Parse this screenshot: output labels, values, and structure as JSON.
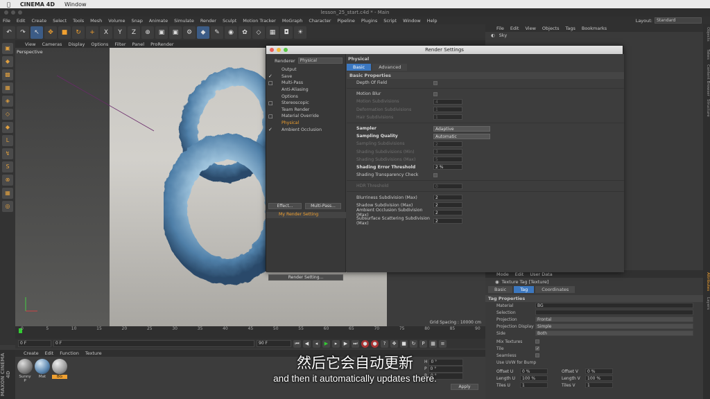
{
  "mac": {
    "app": "CINEMA 4D",
    "window_menu": "Window"
  },
  "window_title": "lesson_25_start.c4d * - Main",
  "menubar": [
    "File",
    "Edit",
    "Create",
    "Select",
    "Tools",
    "Mesh",
    "Volume",
    "Snap",
    "Animate",
    "Simulate",
    "Render",
    "Sculpt",
    "Motion Tracker",
    "MoGraph",
    "Character",
    "Pipeline",
    "Plugins",
    "Script",
    "Window",
    "Help"
  ],
  "layout": {
    "label": "Layout:",
    "value": "Standard"
  },
  "viewport": {
    "menu": [
      "View",
      "Cameras",
      "Display",
      "Options",
      "Filter",
      "Panel",
      "ProRender"
    ],
    "camera": "Perspective",
    "grid_spacing": "Grid Spacing : 10000 cm"
  },
  "timeline": {
    "ticks": [
      "0",
      "5",
      "10",
      "15",
      "20",
      "25",
      "30",
      "35",
      "40",
      "45",
      "50",
      "55",
      "60",
      "65",
      "70",
      "75",
      "80",
      "85",
      "90"
    ],
    "start": "0 F",
    "current": "0 F",
    "end_left": "90 F",
    "end_right": "90 F",
    "frame": "0 F"
  },
  "materials": {
    "menu": [
      "Create",
      "Edit",
      "Function",
      "Texture"
    ],
    "items": [
      {
        "name": "Sunny P",
        "color": "#7a7a7a"
      },
      {
        "name": "Mat",
        "color": "#5a86b0"
      },
      {
        "name": "BG",
        "color": "#9a9a9a"
      }
    ],
    "selected": "BG"
  },
  "maxon": "MAXON CINEMA 4D",
  "objects": {
    "menu": [
      "File",
      "Edit",
      "View",
      "Objects",
      "Tags",
      "Bookmarks"
    ],
    "first_object": "Sky"
  },
  "attributes": {
    "menu": [
      "Mode",
      "Edit",
      "User Data"
    ],
    "title": "Texture Tag [Texture]",
    "tabs": [
      "Basic",
      "Tag",
      "Coordinates"
    ],
    "active_tab": "Tag",
    "section": "Tag Properties",
    "material": {
      "label": "Material",
      "value": "BG"
    },
    "selection": {
      "label": "Selection",
      "value": ""
    },
    "projection": {
      "label": "Projection",
      "value": "Frontal"
    },
    "projection_display": {
      "label": "Projection Display",
      "value": "Simple"
    },
    "side": {
      "label": "Side",
      "value": "Both"
    },
    "mix_textures": "Mix Textures",
    "tile": {
      "label": "Tile",
      "value": "✓"
    },
    "seamless": "Seamless",
    "use_uvw": "Use UVW for Bump",
    "offset_u": {
      "label": "Offset U",
      "value": "0 %"
    },
    "offset_v": {
      "label": "Offset V",
      "value": "0 %"
    },
    "length_u": {
      "label": "Length U",
      "value": "100 %"
    },
    "length_v": {
      "label": "Length V",
      "value": "100 %"
    },
    "tiles_u": {
      "label": "Tiles U",
      "value": "1"
    },
    "tiles_v": {
      "label": "Tiles V",
      "value": "1"
    },
    "apply": "Apply"
  },
  "coords": {
    "h": "H",
    "h_val": "0 °",
    "p": "P",
    "p_val": "0 °",
    "b": "B",
    "b_val": "0 °"
  },
  "render_settings": {
    "title": "Render Settings",
    "renderer_label": "Renderer",
    "renderer_value": "Physical",
    "items": [
      {
        "name": "Output",
        "check": ""
      },
      {
        "name": "Save",
        "check": "✓"
      },
      {
        "name": "Multi-Pass",
        "check": "□"
      },
      {
        "name": "Anti-Aliasing",
        "check": ""
      },
      {
        "name": "Options",
        "check": ""
      },
      {
        "name": "Stereoscopic",
        "check": "□"
      },
      {
        "name": "Team Render",
        "check": ""
      },
      {
        "name": "Material Override",
        "check": "□"
      },
      {
        "name": "Physical",
        "check": ""
      },
      {
        "name": "Ambient Occlusion",
        "check": "✓"
      }
    ],
    "active_item": "Physical",
    "effect_button": "Effect...",
    "multipass_button": "Multi-Pass...",
    "my_setting": "My Render Setting",
    "render_setting_button": "Render Setting...",
    "header": "Physical",
    "tabs": [
      "Basic",
      "Advanced"
    ],
    "section": "Basic Properties",
    "depth_of_field": "Depth Of Field",
    "motion_blur": "Motion Blur",
    "motion_subdivisions": {
      "label": "Motion Subdivisions",
      "value": "4"
    },
    "deformation_subdivisions": {
      "label": "Deformation Subdivisions",
      "value": "1"
    },
    "hair_subdivisions": {
      "label": "Hair Subdivisions",
      "value": "1"
    },
    "sampler": {
      "label": "Sampler",
      "value": "Adaptive"
    },
    "sampling_quality": {
      "label": "Sampling Quality",
      "value": "Automatic"
    },
    "sampling_subdivisions": {
      "label": "Sampling Subdivisions",
      "value": "2"
    },
    "shading_sub_min": {
      "label": "Shading Subdivisions (Min)",
      "value": "3"
    },
    "shading_sub_max": {
      "label": "Shading Subdivisions (Max)",
      "value": "5"
    },
    "shading_error": {
      "label": "Shading Error Threshold",
      "value": "2 %"
    },
    "shading_transparency": "Shading Transparency Check",
    "hdr_threshold": {
      "label": "HDR Threshold",
      "value": "0"
    },
    "blurriness": {
      "label": "Blurriness Subdivision (Max)",
      "value": "2"
    },
    "shadow": {
      "label": "Shadow Subdivision (Max)",
      "value": "2"
    },
    "ao": {
      "label": "Ambient Occlusion Subdivision (Max)",
      "value": "2"
    },
    "sss": {
      "label": "Subsurface Scattering Subdivision (Max)",
      "value": "2"
    }
  },
  "right_tabs": [
    "Objects",
    "Takes",
    "Content Browser",
    "Structure",
    "Attributes",
    "Layers"
  ],
  "subtitles": {
    "zh": "然后它会自动更新",
    "en": "and then it automatically updates there."
  }
}
